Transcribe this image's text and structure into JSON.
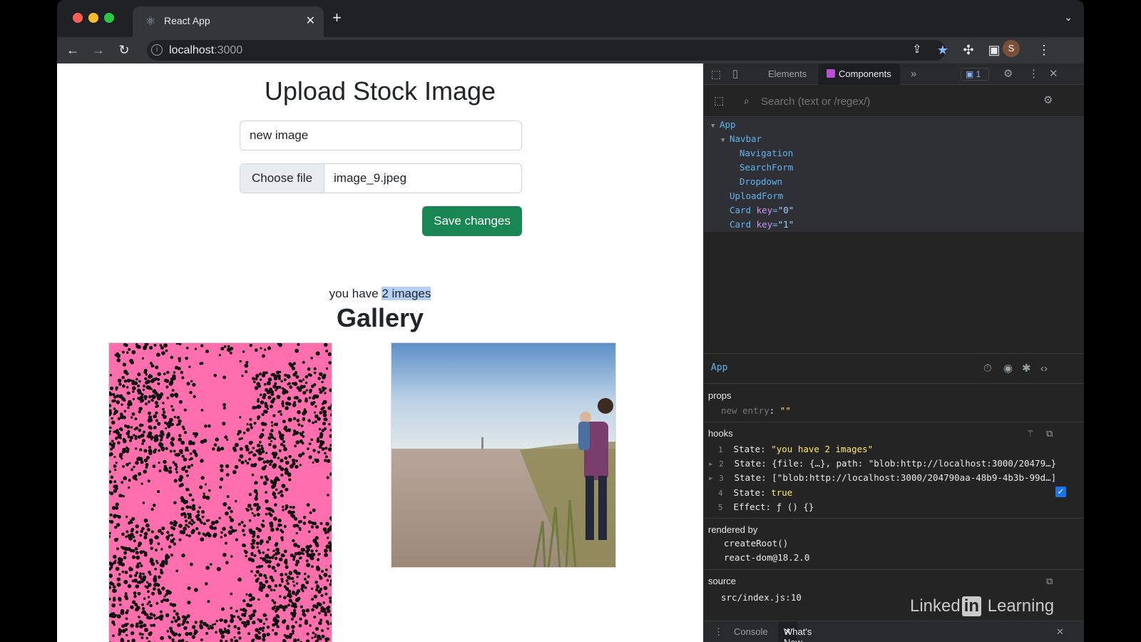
{
  "tab": {
    "title": "React App"
  },
  "address": {
    "host": "localhost",
    "port": ":3000"
  },
  "profile": {
    "initial": "S"
  },
  "page": {
    "heading": "Upload Stock Image",
    "name_value": "new image",
    "choose_file": "Choose file",
    "file_name": "image_9.jpeg",
    "save_button": "Save changes",
    "count_prefix": "you have ",
    "count_highlight": "2 images",
    "gallery_title": "Gallery"
  },
  "devtools": {
    "tabs": {
      "elements": "Elements",
      "components": "Components"
    },
    "issues_count": "1",
    "search_placeholder": "Search (text or /regex/)",
    "tree": {
      "app": "App",
      "navbar": "Navbar",
      "navigation": "Navigation",
      "searchform": "SearchForm",
      "dropdown": "Dropdown",
      "uploadform": "UploadForm",
      "card": "Card",
      "key_label": "key",
      "card0_key": "\"0\"",
      "card1_key": "\"1\""
    },
    "inspector": {
      "name": "App",
      "props_title": "props",
      "prop_name": "new entry",
      "prop_value": "\"\"",
      "hooks_title": "hooks",
      "hooks": [
        {
          "num": "1",
          "label": "State:",
          "value": "\"you have 2 images\""
        },
        {
          "num": "2",
          "label": "State:",
          "value": "{file: {…}, path: \"blob:http://localhost:3000/20479…}"
        },
        {
          "num": "3",
          "label": "State:",
          "value": "[\"blob:http://localhost:3000/204790aa-48b9-4b3b-99d…]"
        },
        {
          "num": "4",
          "label": "State:",
          "value": "true"
        },
        {
          "num": "5",
          "label": "Effect:",
          "value": "ƒ () {}"
        }
      ],
      "rendered_title": "rendered by",
      "rendered": [
        "createRoot()",
        "react-dom@18.2.0"
      ],
      "source_title": "source",
      "source_value": "src/index.js:10"
    },
    "drawer": {
      "console": "Console",
      "whats_new": "What's New"
    }
  },
  "watermark": {
    "pre": "Linked",
    "in": "in",
    "post": " Learning"
  }
}
